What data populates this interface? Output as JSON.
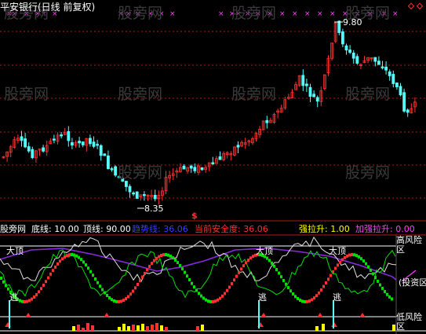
{
  "title": "平安银行(日线 前复权)",
  "watermarks": [
    "股旁网",
    "股旁网",
    "股旁网",
    "股旁网",
    "股旁网",
    "股旁网",
    "股旁网",
    "股旁网",
    "股旁网",
    "股旁网"
  ],
  "price_panel": {
    "high_label": "9.80",
    "low_label": "8.35",
    "dollar_mark": "$"
  },
  "indicator_bar": {
    "source": "股旁网",
    "items": [
      {
        "text": "底线: 10.00",
        "color": "#ffffff"
      },
      {
        "text": "顶线: 90.00",
        "color": "#ffffff"
      },
      {
        "text": "趋势线: 36.06",
        "color": "#3b3bff"
      },
      {
        "text": "当前安全度: 36.06",
        "color": "#ff3030"
      },
      {
        "text": "强拉升: 1.00",
        "color": "#ffff00"
      },
      {
        "text": "加强拉升: 0.00",
        "color": "#ff40ff"
      }
    ]
  },
  "indicator_panel": {
    "right_labels": [
      "高风险区",
      "(投资区",
      "低风险区"
    ],
    "labels": {
      "top1": "大顶",
      "top2": "大顶",
      "top3": "大顶",
      "escape1": "逃",
      "escape2": "逃",
      "escape3": "逃"
    }
  },
  "colors": {
    "up": "#ff3030",
    "down": "#54ffff",
    "grid": "#b01818",
    "trend": "#3b3bff",
    "safety_line": "#ffffff",
    "green": "#00e000",
    "yellow": "#ffff00"
  }
}
